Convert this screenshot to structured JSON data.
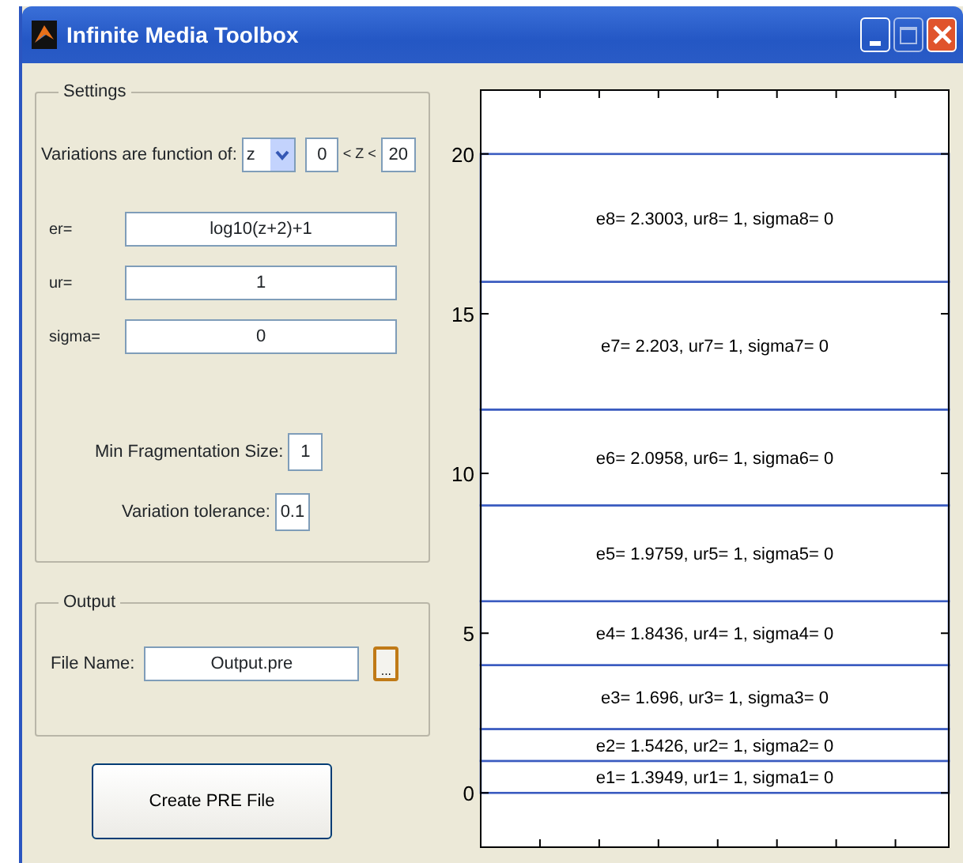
{
  "window": {
    "title": "Infinite Media Toolbox"
  },
  "settings": {
    "title": "Settings",
    "variation_label": "Variations are function of:",
    "variable": "z",
    "range_min": "0",
    "range_op": "< Z <",
    "range_max": "20",
    "parameters": [
      {
        "label": "er=",
        "value": "log10(z+2)+1"
      },
      {
        "label": "ur=",
        "value": "1"
      },
      {
        "label": "sigma=",
        "value": "0"
      }
    ],
    "min_fragmentation": {
      "label": "Min Fragmentation Size:",
      "value": "1"
    },
    "tolerance": {
      "label": "Variation tolerance:",
      "value": "0.1"
    }
  },
  "output": {
    "title": "Output",
    "file_label": "File Name:",
    "file_value": "Output.pre",
    "browse_label": "..."
  },
  "create_button": "Create PRE File",
  "plot": {
    "chart_data": {
      "type": "bar",
      "stacked": true,
      "categories": [
        null
      ],
      "ylim": [
        -1.7,
        22
      ],
      "yticks": [
        0,
        5,
        10,
        15,
        20
      ],
      "series": [
        {
          "name": "e1= 1.3949, ur1= 1, sigma1= 0",
          "color": "#ffffff",
          "values": [
            1
          ]
        },
        {
          "name": "e2= 1.5426, ur2= 1, sigma2= 0",
          "color": "#ffffff",
          "values": [
            1
          ]
        },
        {
          "name": "e3= 1.696, ur3= 1, sigma3= 0",
          "color": "#ffffff",
          "values": [
            2
          ]
        },
        {
          "name": "e4= 1.8436, ur4= 1, sigma4= 0",
          "color": "#ffffff",
          "values": [
            2
          ]
        },
        {
          "name": "e5= 1.9759, ur5= 1, sigma5= 0",
          "color": "#ffffff",
          "values": [
            3
          ]
        },
        {
          "name": "e6= 2.0958, ur6= 1, sigma6= 0",
          "color": "#ffffff",
          "values": [
            3
          ]
        },
        {
          "name": "e7= 2.203, ur7= 1, sigma7= 0",
          "color": "#ffffff",
          "values": [
            4
          ]
        },
        {
          "name": "e8= 2.3003, ur8= 1, sigma8= 0",
          "color": "#ffffff",
          "values": [
            4
          ]
        }
      ]
    }
  }
}
